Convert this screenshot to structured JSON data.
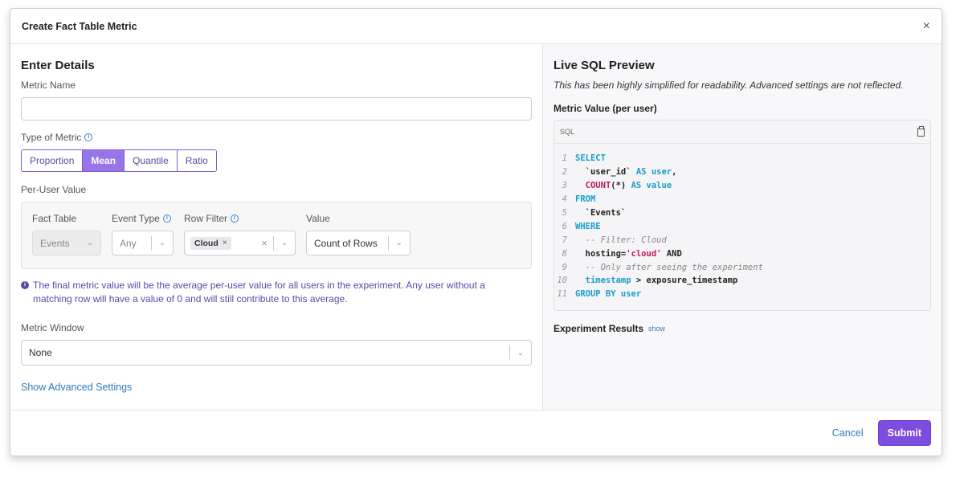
{
  "modal": {
    "title": "Create Fact Table Metric",
    "close": "×"
  },
  "left": {
    "heading": "Enter Details",
    "metric_name_label": "Metric Name",
    "metric_name_value": "",
    "type_label": "Type of Metric",
    "types": [
      "Proportion",
      "Mean",
      "Quantile",
      "Ratio"
    ],
    "active_type": "Mean",
    "per_user_label": "Per-User Value",
    "fact_table": {
      "label": "Fact Table",
      "value": "Events"
    },
    "event_type": {
      "label": "Event Type",
      "value": "Any"
    },
    "row_filter": {
      "label": "Row Filter",
      "chip": "Cloud"
    },
    "value": {
      "label": "Value",
      "value": "Count of Rows"
    },
    "note": "The final metric value will be the average per-user value for all users in the experiment. Any user without a matching row will have a value of 0 and will still contribute to this average.",
    "window_label": "Metric Window",
    "window_value": "None",
    "advanced_link": "Show Advanced Settings"
  },
  "right": {
    "heading": "Live SQL Preview",
    "subtitle": "This has been highly simplified for readability. Advanced settings are not reflected.",
    "metric_value_label": "Metric Value (per user)",
    "code_lang": "SQL",
    "code_lines": [
      {
        "n": "1",
        "parts": [
          [
            "kw",
            "SELECT"
          ]
        ]
      },
      {
        "n": "2",
        "parts": [
          [
            "pl",
            "  `user_id` "
          ],
          [
            "kw",
            "AS user"
          ],
          [
            "pl",
            ","
          ]
        ]
      },
      {
        "n": "3",
        "parts": [
          [
            "pl",
            "  "
          ],
          [
            "str",
            "COUNT"
          ],
          [
            "pl",
            "(*) "
          ],
          [
            "kw",
            "AS value"
          ]
        ]
      },
      {
        "n": "4",
        "parts": [
          [
            "kw",
            "FROM"
          ]
        ]
      },
      {
        "n": "5",
        "parts": [
          [
            "pl",
            "  `Events`"
          ]
        ]
      },
      {
        "n": "6",
        "parts": [
          [
            "kw",
            "WHERE"
          ]
        ]
      },
      {
        "n": "7",
        "parts": [
          [
            "cm",
            "  -- Filter: Cloud"
          ]
        ]
      },
      {
        "n": "8",
        "parts": [
          [
            "pl",
            "  hosting="
          ],
          [
            "str",
            "'cloud'"
          ],
          [
            "pl",
            " AND"
          ]
        ]
      },
      {
        "n": "9",
        "parts": [
          [
            "cm",
            "  -- Only after seeing the experiment"
          ]
        ]
      },
      {
        "n": "10",
        "parts": [
          [
            "kw",
            "  timestamp"
          ],
          [
            "pl",
            " > exposure_timestamp"
          ]
        ]
      },
      {
        "n": "11",
        "parts": [
          [
            "kw",
            "GROUP BY user"
          ]
        ]
      }
    ],
    "results_label": "Experiment Results",
    "results_link": "show"
  },
  "footer": {
    "cancel": "Cancel",
    "submit": "Submit"
  }
}
